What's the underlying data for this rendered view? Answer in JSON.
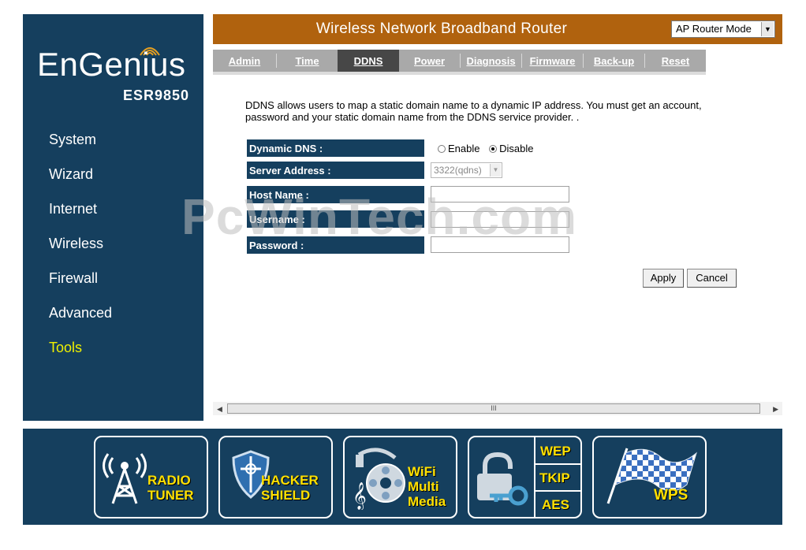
{
  "brand": {
    "logo": "EnGenius",
    "model": "ESR9850"
  },
  "sidebar": {
    "items": [
      {
        "label": "System"
      },
      {
        "label": "Wizard"
      },
      {
        "label": "Internet"
      },
      {
        "label": "Wireless"
      },
      {
        "label": "Firewall"
      },
      {
        "label": "Advanced"
      },
      {
        "label": "Tools",
        "active": true
      }
    ],
    "active_color": "#f0f000"
  },
  "header": {
    "title": "Wireless Network Broadband Router",
    "mode_select": "AP Router Mode",
    "bg_color": "#b0620e"
  },
  "tabs": [
    {
      "label": "Admin"
    },
    {
      "label": "Time"
    },
    {
      "label": "DDNS",
      "active": true
    },
    {
      "label": "Power"
    },
    {
      "label": "Diagnosis"
    },
    {
      "label": "Firmware"
    },
    {
      "label": "Back-up"
    },
    {
      "label": "Reset"
    }
  ],
  "ddns": {
    "description": "DDNS allows users to map a static domain name to a dynamic IP address. You must get an account, password and your static domain name from the DDNS service provider. .",
    "labels": {
      "dynamic_dns": "Dynamic DNS :",
      "server_address": "Server Address :",
      "host_name": "Host Name :",
      "username": "Username :",
      "password": "Password :"
    },
    "radio": {
      "enable": "Enable",
      "disable": "Disable",
      "selected": "disable"
    },
    "server_address_value": "3322(qdns)",
    "host_name_value": "",
    "username_value": "",
    "password_value": ""
  },
  "buttons": {
    "apply": "Apply",
    "cancel": "Cancel"
  },
  "watermark": "PcWinTech.com",
  "scrollbar": {
    "thumb_label": "III"
  },
  "footer": {
    "features": [
      {
        "name": "radio-tuner",
        "lines": [
          "RADIO",
          "TUNER"
        ],
        "icon": "radio-tower-icon"
      },
      {
        "name": "hacker-shield",
        "lines": [
          "HACKER",
          "SHIELD"
        ],
        "icon": "shield-icon"
      },
      {
        "name": "wifi-multimedia",
        "lines": [
          "WiFi",
          "Multi",
          "Media"
        ],
        "icon": "music-disc-icon"
      },
      {
        "name": "security",
        "lines": [
          "WEP",
          "TKIP",
          "AES"
        ],
        "icon": "padlock-key-icon"
      },
      {
        "name": "wps",
        "lines": [
          "WPS"
        ],
        "icon": "checkered-flag-icon"
      }
    ],
    "text_color": "#ffe000"
  },
  "colors": {
    "navy": "#153f5e",
    "tab_gray": "#a9a9a9",
    "tab_active": "#474747"
  }
}
